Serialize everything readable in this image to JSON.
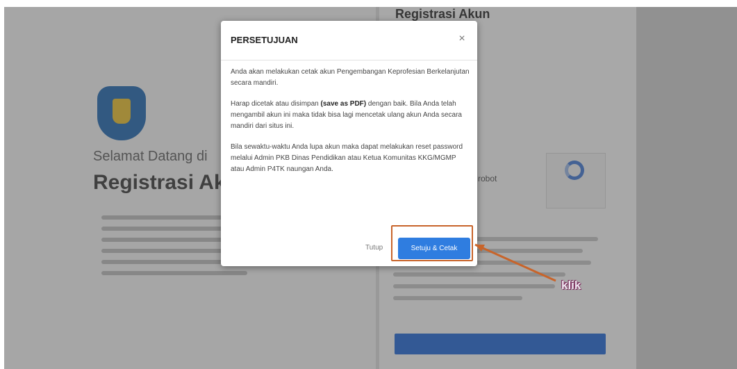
{
  "background": {
    "welcome_text": "Selamat Datang di",
    "big_title": "Registrasi Ak",
    "right_title": "Registrasi Akun",
    "robot_text": "robot"
  },
  "modal": {
    "title": "PERSETUJUAN",
    "close_symbol": "×",
    "paragraph1": "Anda akan melakukan cetak akun Pengembangan Keprofesian Berkelanjutan secara mandiri.",
    "paragraph2_before": "Harap dicetak atau disimpan ",
    "paragraph2_bold": "(save as PDF)",
    "paragraph2_after": " dengan baik. Bila Anda telah mengambil akun ini maka tidak bisa lagi mencetak ulang akun Anda secara mandiri dari situs ini.",
    "paragraph3": "Bila sewaktu-waktu Anda lupa akun maka dapat melakukan reset password melalui Admin PKB Dinas Pendidikan atau Ketua Komunitas KKG/MGMP atau Admin P4TK naungan Anda.",
    "close_button_label": "Tutup",
    "agree_button_label": "Setuju & Cetak"
  },
  "annotation": {
    "label": "klik",
    "color": "#c8642a"
  },
  "colors": {
    "primary_button": "#2f7de0",
    "overlay": "rgba(60,60,60,0.42)"
  }
}
